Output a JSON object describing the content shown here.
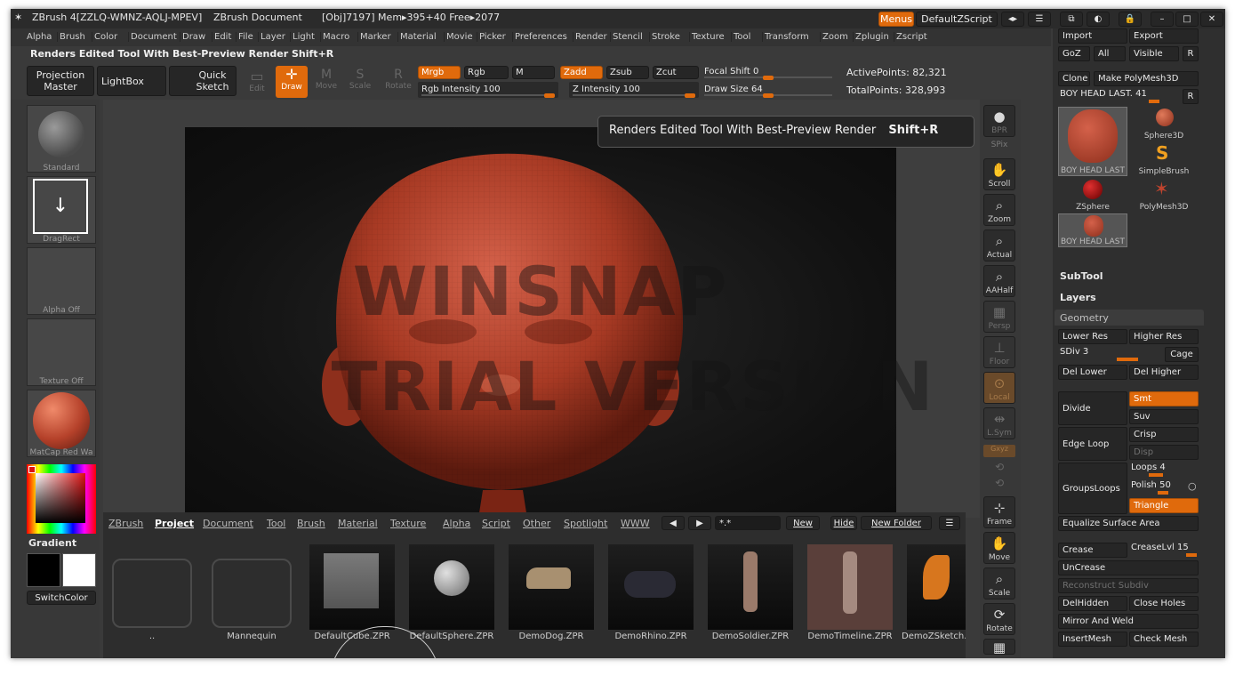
{
  "title": {
    "app": "ZBrush 4[ZZLQ-WMNZ-AQLJ-MPEV]",
    "doc": "ZBrush Document",
    "stats": "[Obj]7197] Mem▸395+40 Free▸2077",
    "menus_btn": "Menus",
    "script_btn": "DefaultZScript"
  },
  "menu": [
    "Alpha",
    "Brush",
    "Color",
    "Document",
    "Draw",
    "Edit",
    "File",
    "Layer",
    "Light",
    "Macro",
    "Marker",
    "Material",
    "Movie",
    "Picker",
    "Preferences",
    "Render",
    "Stencil",
    "Stroke",
    "Texture",
    "Tool",
    "Transform",
    "Zoom",
    "Zplugin",
    "Zscript"
  ],
  "tip": {
    "text": "Renders Edited Tool With Best-Preview Render",
    "shortcut": "Shift+R"
  },
  "toolbar": {
    "projection_master": "Projection Master",
    "lightbox": "LightBox",
    "quick_sketch": "Quick Sketch",
    "edit": "Edit",
    "draw": "Draw",
    "move": "Move",
    "scale": "Scale",
    "rotate": "Rotate",
    "mrgb": "Mrgb",
    "rgb": "Rgb",
    "m": "M",
    "zadd": "Zadd",
    "zsub": "Zsub",
    "zcut": "Zcut",
    "rgb_intensity": "Rgb Intensity 100",
    "z_intensity": "Z Intensity 100",
    "focal_shift": "Focal Shift 0",
    "draw_size": "Draw Size 64",
    "active_points": "ActivePoints: 82,321",
    "total_points": "TotalPoints: 328,993"
  },
  "left_shelf": {
    "standard": "Standard",
    "dragrect": "DragRect",
    "alpha_off": "Alpha Off",
    "texture_off": "Texture Off",
    "matcap": "MatCap Red Wa",
    "gradient": "Gradient",
    "switchcolor": "SwitchColor"
  },
  "right_shelf": {
    "bpr": "BPR",
    "spix": "SPix",
    "scroll": "Scroll",
    "zoom": "Zoom",
    "actual": "Actual",
    "aahalf": "AAHalf",
    "persp": "Persp",
    "floor": "Floor",
    "local": "Local",
    "lsym": "L.Sym",
    "xyz": "Gxyz",
    "frame": "Frame",
    "move": "Move",
    "scale": "Scale",
    "rotate": "Rotate"
  },
  "watermark": {
    "line1": "WINSNAP",
    "line2": "TRIAL VERSION"
  },
  "tooltip": {
    "text": "Renders Edited Tool With Best-Preview Render",
    "shortcut": "Shift+R"
  },
  "tray": {
    "import": "Import",
    "export": "Export",
    "goz": "GoZ",
    "all": "All",
    "visible": "Visible",
    "r": "R",
    "clone": "Clone",
    "make_polymesh": "Make PolyMesh3D",
    "current_tool": "BOY HEAD LAST. 41",
    "tools": [
      {
        "label": "BOY HEAD LAST"
      },
      {
        "label": "Sphere3D"
      },
      {
        "label": "SimpleBrush"
      },
      {
        "label": "ZSphere"
      },
      {
        "label": "PolyMesh3D"
      },
      {
        "label": "BOY HEAD LAST"
      }
    ],
    "subtool": "SubTool",
    "layers": "Layers",
    "geometry": "Geometry",
    "lower_res": "Lower Res",
    "higher_res": "Higher Res",
    "sdiv": "SDiv 3",
    "cage": "Cage",
    "del_lower": "Del Lower",
    "del_higher": "Del Higher",
    "divide": "Divide",
    "smt": "Smt",
    "suv": "Suv",
    "edge_loop": "Edge Loop",
    "crisp": "Crisp",
    "disp": "Disp",
    "groupsloops": "GroupsLoops",
    "loops": "Loops 4",
    "polish": "Polish 50",
    "triangle": "Triangle",
    "equalize": "Equalize Surface Area",
    "crease": "Crease",
    "creaselvl": "CreaseLvl 15",
    "uncrease": "UnCrease",
    "reconstruct": "Reconstruct Subdiv",
    "delhidden": "DelHidden",
    "close_holes": "Close Holes",
    "mirror_weld": "Mirror And Weld",
    "insertmesh": "InsertMesh",
    "check_mesh": "Check Mesh"
  },
  "lightbox": {
    "tabs": [
      "ZBrush",
      "Project",
      "Document",
      "Tool",
      "Brush",
      "Material",
      "Texture",
      "Alpha",
      "Script",
      "Other",
      "Spotlight",
      "WWW"
    ],
    "active_tab": "Project",
    "filter": "*.*",
    "new": "New",
    "hide": "Hide",
    "new_folder": "New Folder",
    "items": [
      {
        "label": ".."
      },
      {
        "label": "Mannequin"
      },
      {
        "label": "DefaultCube.ZPR"
      },
      {
        "label": "DefaultSphere.ZPR"
      },
      {
        "label": "DemoDog.ZPR"
      },
      {
        "label": "DemoRhino.ZPR"
      },
      {
        "label": "DemoSoldier.ZPR"
      },
      {
        "label": "DemoTimeline.ZPR"
      },
      {
        "label": "DemoZSketch.ZPR"
      }
    ]
  },
  "colors": {
    "accent": "#e06a0c",
    "head": "#b5412a",
    "bg": "#3a3a3a"
  }
}
